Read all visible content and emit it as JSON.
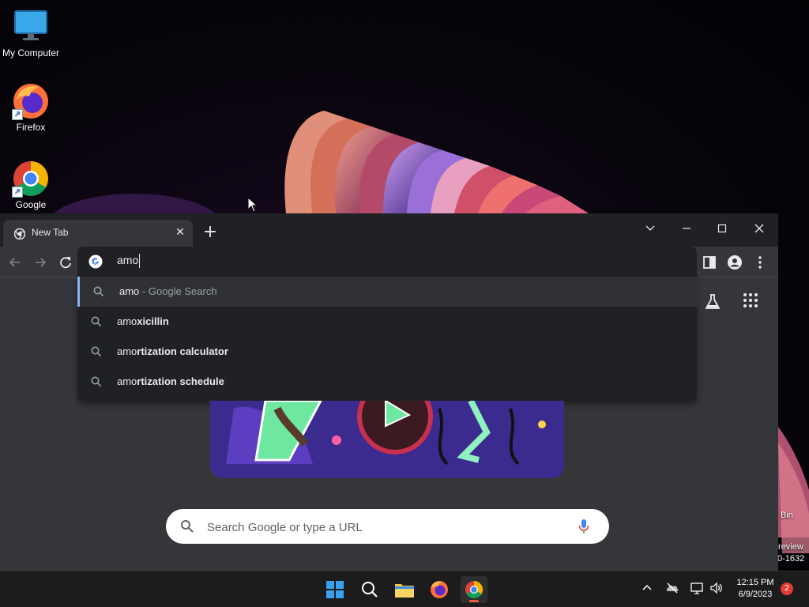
{
  "desktop": {
    "icons": [
      {
        "label": "My Computer",
        "icon": "monitor-icon"
      },
      {
        "label": "Firefox",
        "icon": "firefox-icon"
      },
      {
        "label": "Google",
        "icon": "chrome-icon"
      }
    ],
    "edge_labels": {
      "bin": "Bin",
      "preview": "review",
      "build": "0-1632"
    }
  },
  "browser": {
    "tab": {
      "title": "New Tab"
    },
    "window_controls": [
      "tab-search",
      "minimize",
      "maximize",
      "close"
    ],
    "omnibox": {
      "typed_text": "amo"
    },
    "suggestions": [
      {
        "prefix": "amo",
        "rest": "",
        "suffix": " - Google Search",
        "selected": true
      },
      {
        "prefix": "amo",
        "rest": "xicillin",
        "suffix": "",
        "selected": false
      },
      {
        "prefix": "amo",
        "rest": "rtization calculator",
        "suffix": "",
        "selected": false
      },
      {
        "prefix": "amo",
        "rest": "rtization schedule",
        "suffix": "",
        "selected": false
      }
    ],
    "ntp_search": {
      "placeholder": "Search Google or type a URL"
    }
  },
  "taskbar": {
    "apps": [
      "start-icon",
      "search-icon",
      "file-explorer-icon",
      "firefox-icon",
      "chrome-icon"
    ],
    "clock": {
      "time": "12:15 PM",
      "date": "6/9/2023"
    },
    "notification_count": "2"
  },
  "colors": {
    "accent": "#8ab4f8",
    "omnibox_bg": "#202124",
    "toolbar_bg": "#35363a",
    "taskbar_bg": "#1c1c1c",
    "notif_badge": "#e53935"
  }
}
